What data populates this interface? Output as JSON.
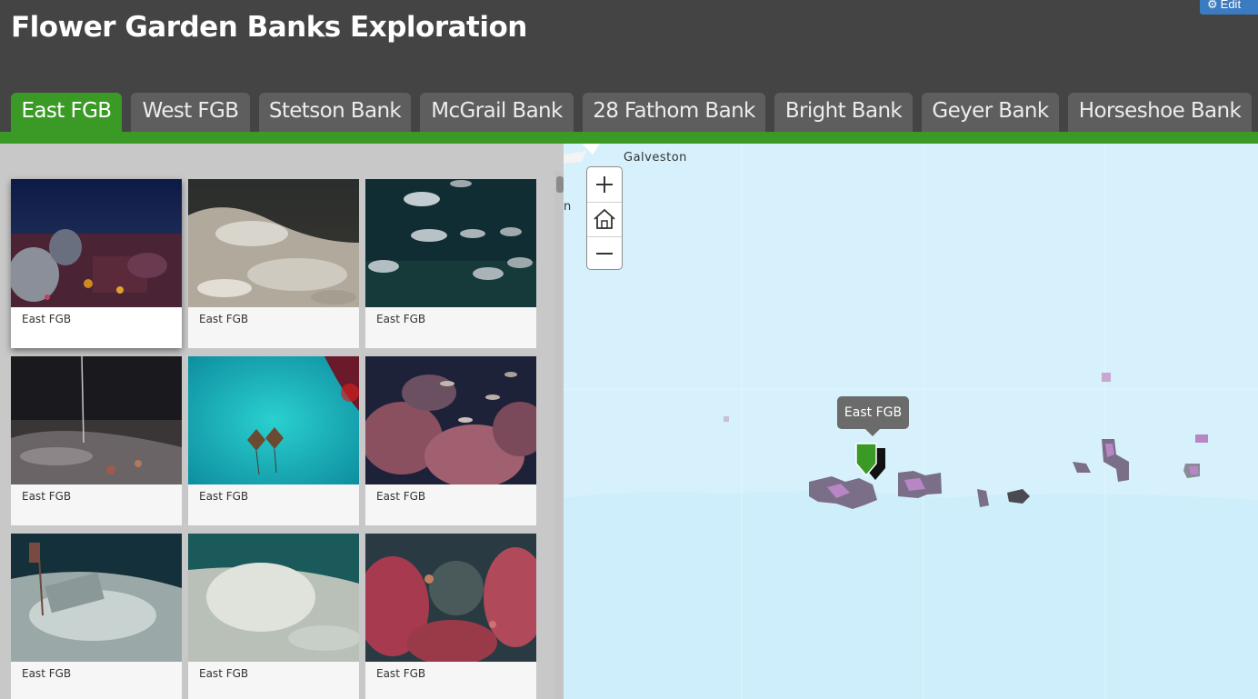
{
  "header": {
    "title": "Flower Garden Banks Exploration",
    "edit_label": "Edit",
    "edit_icon": "gear-icon"
  },
  "tabs": [
    {
      "label": "East FGB",
      "active": true
    },
    {
      "label": "West FGB",
      "active": false
    },
    {
      "label": "Stetson Bank",
      "active": false
    },
    {
      "label": "McGrail Bank",
      "active": false
    },
    {
      "label": "28 Fathom Bank",
      "active": false
    },
    {
      "label": "Bright Bank",
      "active": false
    },
    {
      "label": "Geyer Bank",
      "active": false
    },
    {
      "label": "Horseshoe Bank",
      "active": false
    }
  ],
  "gallery": {
    "items": [
      {
        "caption": "East FGB",
        "selected": true
      },
      {
        "caption": "East FGB"
      },
      {
        "caption": "East FGB"
      },
      {
        "caption": "East FGB"
      },
      {
        "caption": "East FGB"
      },
      {
        "caption": "East FGB"
      },
      {
        "caption": "East FGB"
      },
      {
        "caption": "East FGB"
      },
      {
        "caption": "East FGB"
      }
    ]
  },
  "map": {
    "place_label": "Galveston",
    "place_label_partial": "n",
    "popup_label": "East FGB",
    "zoom_in_icon": "plus-icon",
    "home_icon": "home-icon",
    "zoom_out_icon": "minus-icon",
    "marker_color": "#3a9a25"
  },
  "colors": {
    "header_bg": "#444444",
    "accent_green": "#3a9a25",
    "tab_bg": "#5e5e5e",
    "map_water": "#d6f1fb"
  }
}
